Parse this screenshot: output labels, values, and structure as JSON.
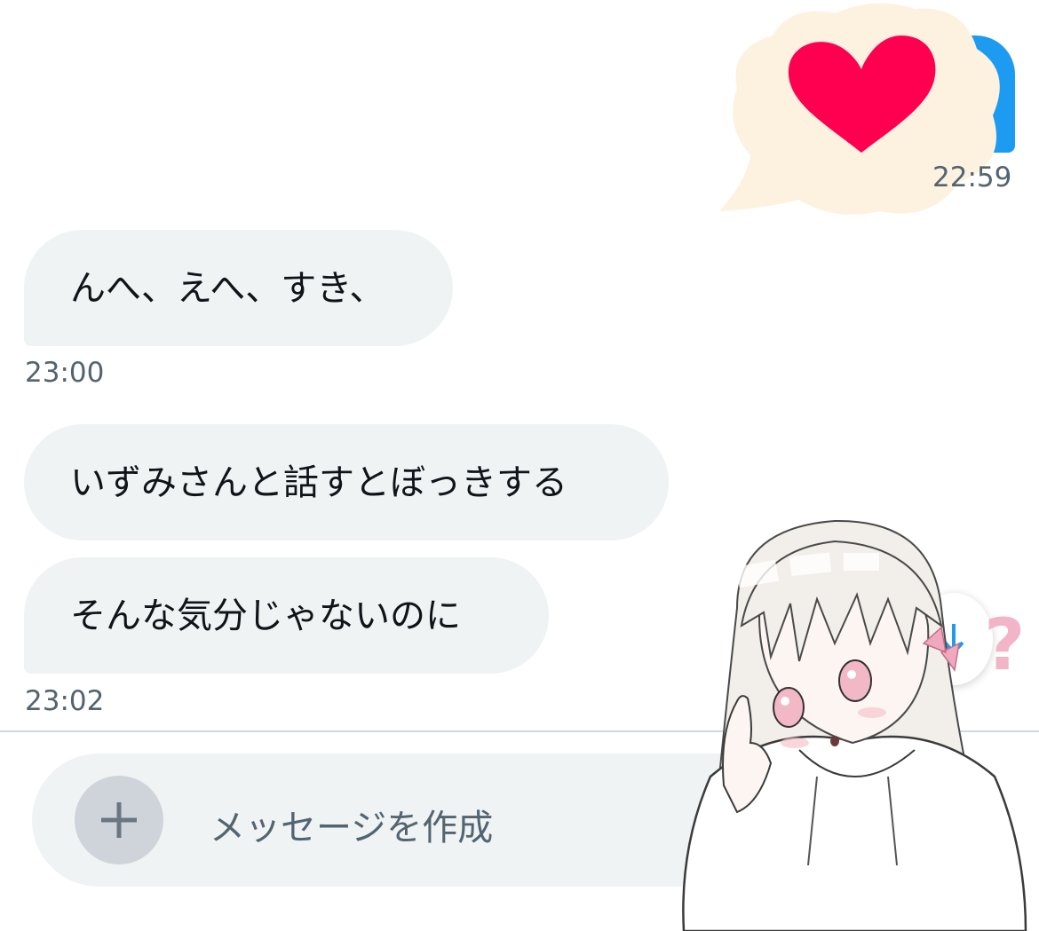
{
  "conversation": {
    "outgoing": {
      "time": "22:59",
      "sticker": "heart-sticker"
    },
    "incoming": [
      {
        "text": "んへ、えへ、すき、"
      },
      {
        "text": "いずみさんと話すとぼっきする"
      },
      {
        "text": "そんな気分じゃないのに"
      }
    ],
    "times": [
      "23:00",
      "23:02"
    ]
  },
  "composer": {
    "add_icon": "plus-icon",
    "placeholder": "メッセージを作成"
  },
  "overlay": {
    "question_mark": "?",
    "scroll_icon": "arrow-down-icon",
    "illustration": "anime-girl-thinking"
  },
  "colors": {
    "accent": "#1d9bf0",
    "bubble_bg": "#eff3f4",
    "text": "#0f1419",
    "muted": "#536471",
    "heart": "#ff0050",
    "cloud": "#fdf2e0"
  }
}
